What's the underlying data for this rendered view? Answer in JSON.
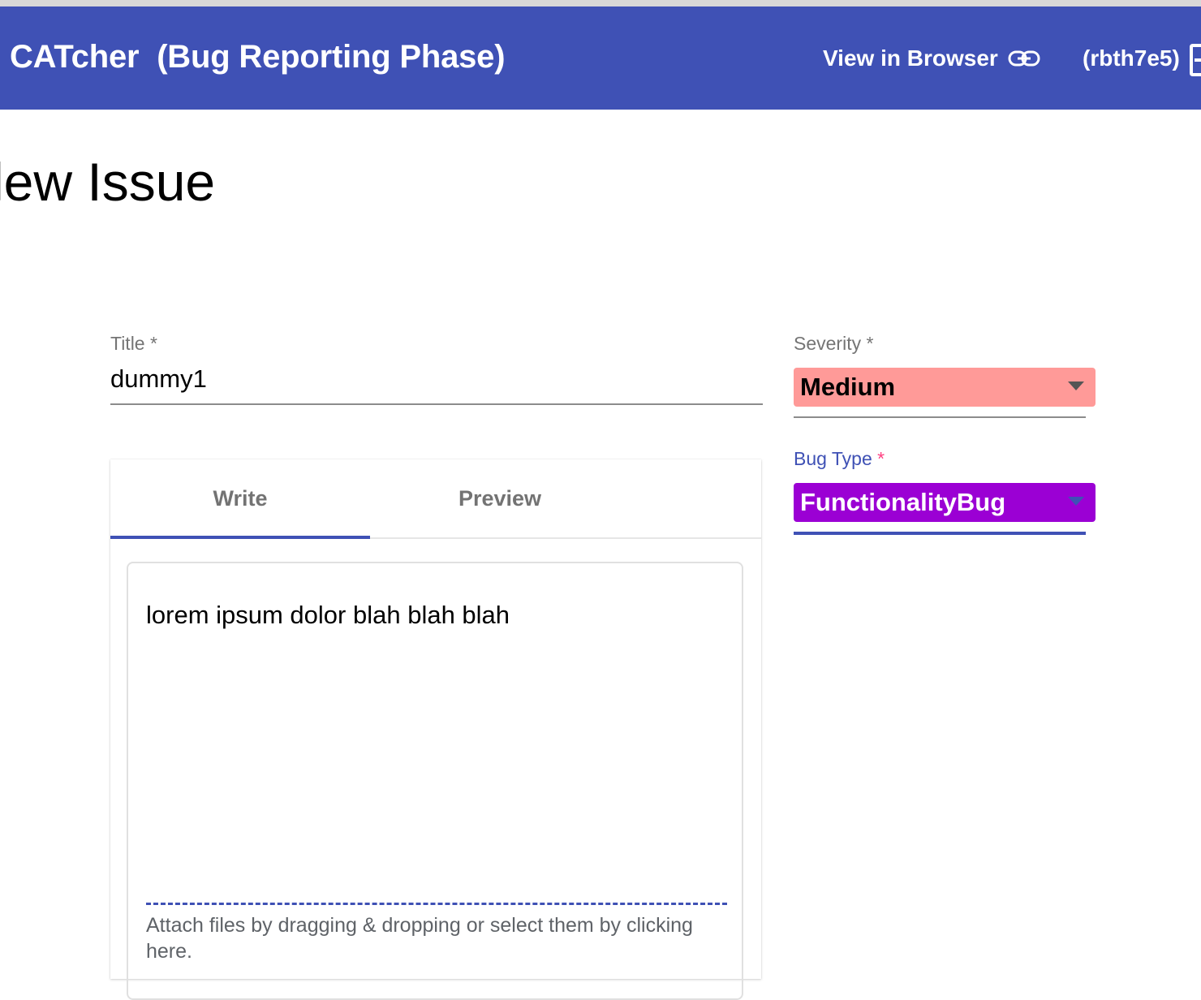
{
  "toolbar": {
    "app_title": "CATcher  (Bug Reporting Phase)",
    "view_in_browser_label": "View in Browser",
    "user_id": "(rbth7e5)"
  },
  "page": {
    "title": "lew Issue"
  },
  "form": {
    "title_label": "Title *",
    "title_value": "dummy1",
    "tabs": [
      {
        "label": "Write",
        "active": true
      },
      {
        "label": "Preview",
        "active": false
      }
    ],
    "description_text": "lorem ipsum dolor blah blah blah",
    "attach_hint": "Attach files by dragging & dropping or select them by clicking here.",
    "severity": {
      "label": "Severity *",
      "value": "Medium",
      "color": "#ff9a98"
    },
    "bug_type": {
      "label": "Bug Type",
      "required_marker": "*",
      "value": "FunctionalityBug",
      "color": "#9b00d4"
    }
  },
  "icons": [
    "link-icon",
    "logout-icon",
    "dropdown-arrow-icon"
  ],
  "colors": {
    "primary": "#3f51b5",
    "accent": "#ff4081"
  }
}
